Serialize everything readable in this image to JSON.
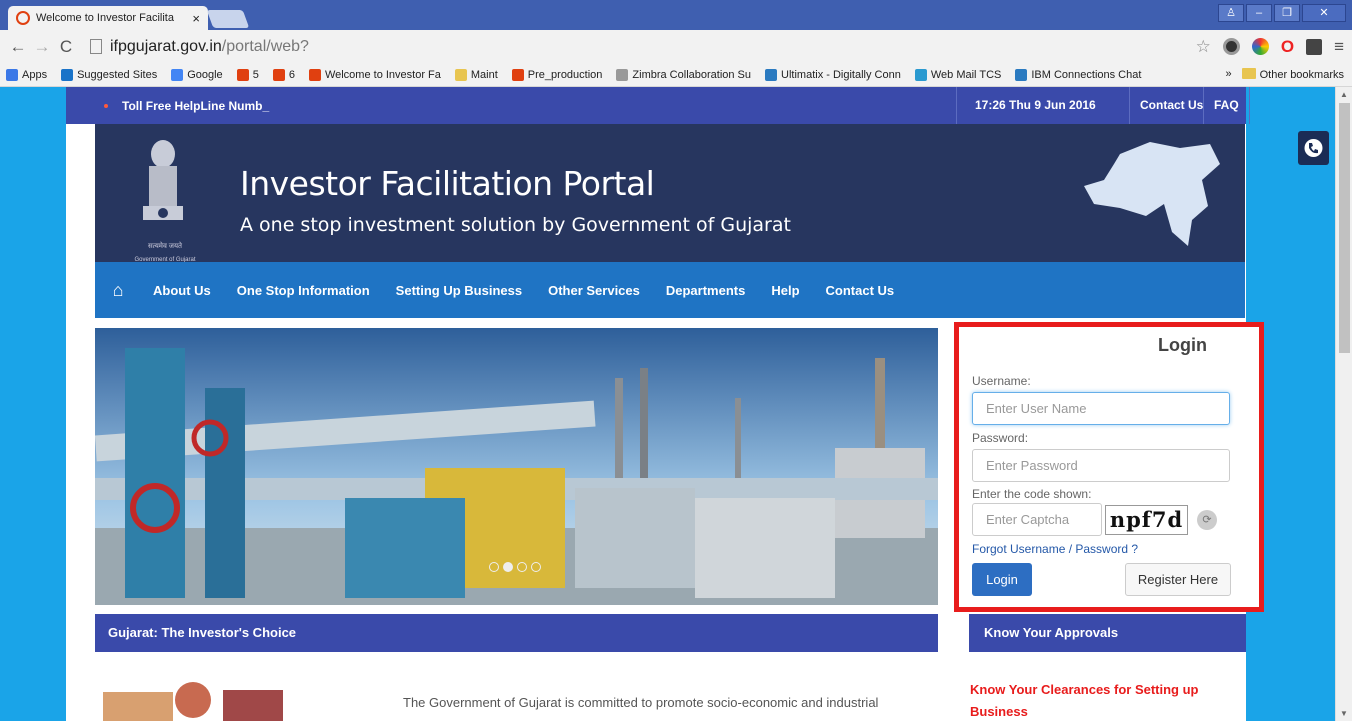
{
  "browser": {
    "tab_title": "Welcome to Investor Facilita",
    "tab_close": "×",
    "url_host": "ifpgujarat.gov.in",
    "url_path": "/portal/web?",
    "bookmarks": [
      {
        "label": "Apps",
        "color": "#3b78e7"
      },
      {
        "label": "Suggested Sites",
        "color": "#1a73c8"
      },
      {
        "label": "Google",
        "color": "#4285f4"
      },
      {
        "label": "5",
        "color": "#e04010"
      },
      {
        "label": "6",
        "color": "#e04010"
      },
      {
        "label": "Welcome to Investor Fa",
        "color": "#e04010"
      },
      {
        "label": "Maint",
        "color": "#e8c550"
      },
      {
        "label": "Pre_production",
        "color": "#e04010"
      },
      {
        "label": "Zimbra Collaboration Su",
        "color": "#999999"
      },
      {
        "label": "Ultimatix - Digitally Conn",
        "color": "#2a7ac0"
      },
      {
        "label": "Web Mail TCS",
        "color": "#2a9ad0"
      },
      {
        "label": "IBM Connections Chat",
        "color": "#2a7ac0"
      }
    ],
    "bookmarks_overflow": "»",
    "other_bookmarks": "Other bookmarks"
  },
  "topbar": {
    "helpline": "Toll Free HelpLine Numb_",
    "datetime": "17:26  Thu  9 Jun 2016",
    "contact": "Contact Us",
    "faq": "FAQ"
  },
  "header": {
    "title": "Investor Facilitation Portal",
    "subtitle": "A one stop investment solution by Government of Gujarat",
    "emblem_motto": "सत्यमेव जयते",
    "emblem_caption": "Government of Gujarat"
  },
  "menu": {
    "home_icon": "⌂",
    "items": [
      "About Us",
      "One Stop Information",
      "Setting Up Business",
      "Other Services",
      "Departments",
      "Help",
      "Contact Us"
    ]
  },
  "login": {
    "title": "Login",
    "username_label": "Username:",
    "username_placeholder": "Enter User Name",
    "password_label": "Password:",
    "password_placeholder": "Enter Password",
    "captcha_label": "Enter the code shown:",
    "captcha_placeholder": "Enter Captcha",
    "captcha_code": "npf7d",
    "forgot": "Forgot Username / Password ?",
    "login_button": "Login",
    "register_button": "Register Here"
  },
  "sections": {
    "left_title": "Gujarat: The Investor's Choice",
    "right_title": "Know Your Approvals",
    "intro_text": "The Government of Gujarat is committed to promote socio-economic and industrial",
    "approvals_link": "Know Your Clearances for Setting up Business"
  },
  "colors": {
    "page_bg": "#1aa4e8",
    "topbar": "#3a4aaa",
    "banner": "#27365f",
    "menubar": "#1f74c4",
    "highlight": "#e81c1c"
  }
}
